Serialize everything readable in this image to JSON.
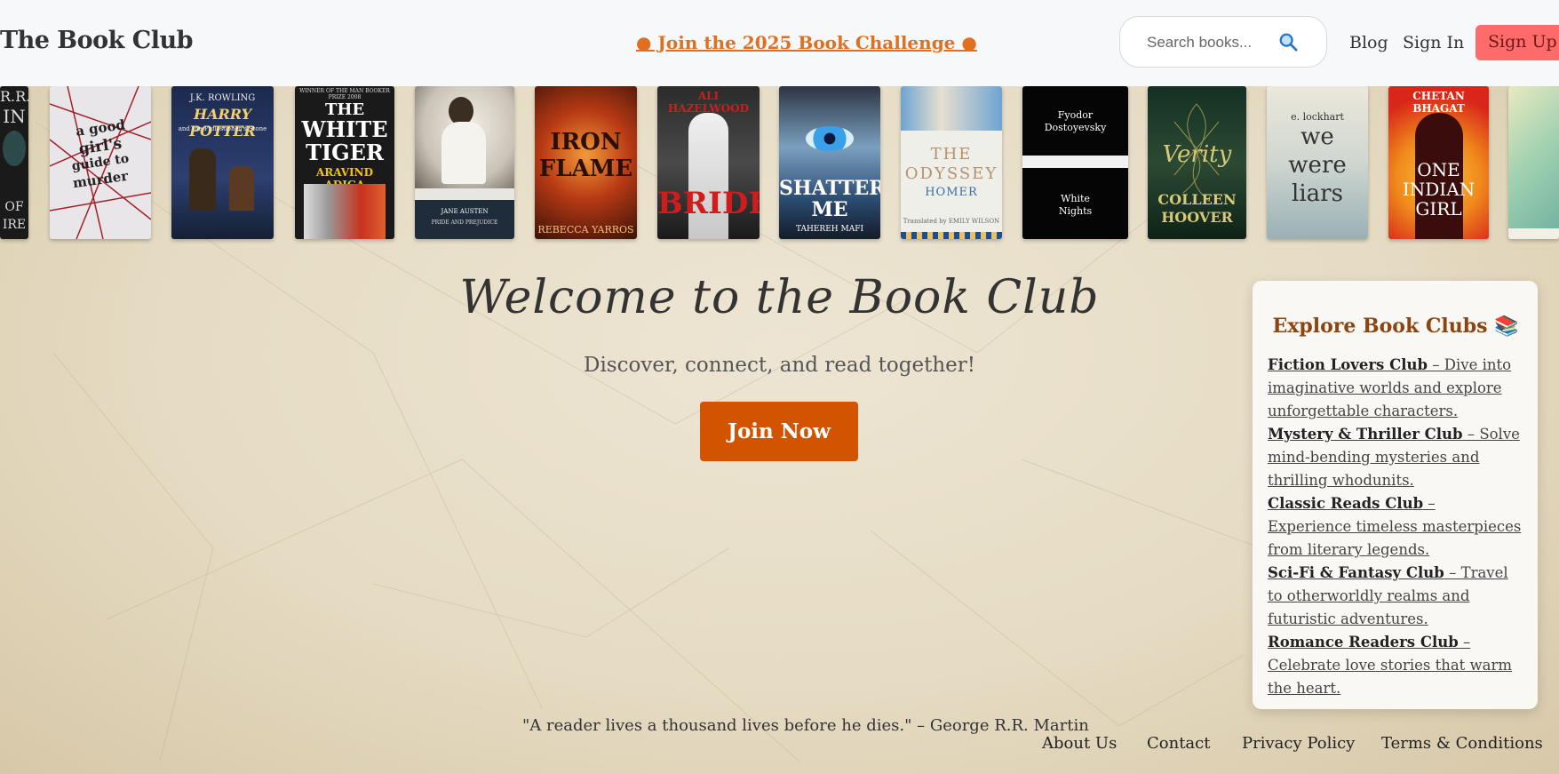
{
  "header": {
    "brand": "The Book Club",
    "challenge": "● Join the 2025 Book Challenge ●",
    "search_placeholder": "Search books...",
    "search_icon": "search-icon",
    "nav": {
      "blog": "Blog",
      "signin": "Sign In",
      "signup": "Sign Up"
    }
  },
  "books": [
    {
      "lines": [
        "R.R.",
        "IN",
        "",
        "OF",
        "IRE"
      ]
    },
    {
      "lines": [
        "a good",
        "girl's",
        "guide to",
        "murder"
      ]
    },
    {
      "lines": [
        "J.K. ROWLING",
        "HARRY POTTER",
        "and the Philosopher's Stone"
      ]
    },
    {
      "lines": [
        "WINNER OF THE MAN BOOKER PRIZE 2008",
        "THE",
        "WHITE",
        "TIGER",
        "ARAVIND ADIGA"
      ]
    },
    {
      "lines": [
        "JANE AUSTEN",
        "PRIDE AND PREJUDICE"
      ]
    },
    {
      "lines": [
        "IRON",
        "FLAME",
        "REBECCA YARROS"
      ]
    },
    {
      "lines": [
        "ALI HAZELWOOD",
        "BRIDE"
      ]
    },
    {
      "lines": [
        "SHATTER",
        "ME",
        "TAHEREH MAFI"
      ]
    },
    {
      "lines": [
        "THE",
        "ODYSSEY",
        "HOMER",
        "Translated by EMILY WILSON"
      ]
    },
    {
      "lines": [
        "Fyodor",
        "Dostoyevsky",
        "White",
        "Nights"
      ]
    },
    {
      "lines": [
        "Verity",
        "COLLEEN",
        "HOOVER"
      ]
    },
    {
      "lines": [
        "e. lockhart",
        "we",
        "were",
        "liars"
      ]
    },
    {
      "lines": [
        "CHETAN BHAGAT",
        "ONE",
        "INDIAN",
        "GIRL"
      ]
    }
  ],
  "hero": {
    "title": "Welcome to the Book Club",
    "subtitle": "Discover, connect, and read together!",
    "button": "Join Now"
  },
  "clubs": {
    "heading": "Explore Book Clubs 📚",
    "items": [
      {
        "name": "Fiction Lovers Club",
        "desc": " – Dive into imaginative worlds and explore unforgettable characters."
      },
      {
        "name": "Mystery & Thriller Club",
        "desc": " – Solve mind-bending mysteries and thrilling whodunits."
      },
      {
        "name": "Classic Reads Club",
        "desc": " – Experience timeless masterpieces from literary legends."
      },
      {
        "name": "Sci-Fi & Fantasy Club",
        "desc": " – Travel to otherworldly realms and futuristic adventures."
      },
      {
        "name": "Romance Readers Club",
        "desc": " – Celebrate love stories that warm the heart."
      }
    ]
  },
  "quote": "\"A reader lives a thousand lives before he dies.\" – George R.R. Martin",
  "footer": {
    "about": "About Us",
    "contact": "Contact",
    "privacy": "Privacy Policy",
    "terms": "Terms & Conditions"
  },
  "colors": {
    "accent": "#d35400",
    "challenge": "#e07020",
    "signup": "#ff6b6b",
    "club_heading": "#8b4513"
  }
}
